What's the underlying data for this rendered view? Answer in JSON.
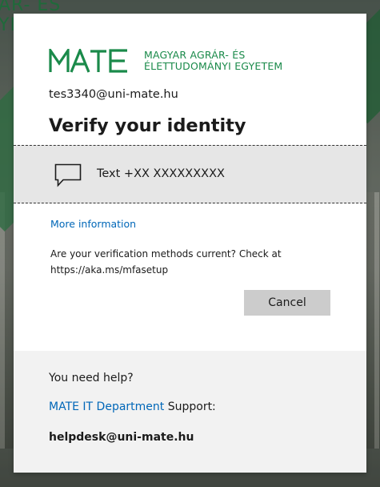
{
  "background": {
    "institution_text": "ÁR- ÉS\nYI"
  },
  "logo": {
    "mark": "MATE",
    "line1": "MAGYAR AGRÁR- ÉS",
    "line2": "ÉLETTUDOMÁNYI EGYETEM",
    "brand_color": "#1a8a4a"
  },
  "account_email": "tes3340@uni-mate.hu",
  "title": "Verify your identity",
  "method": {
    "icon": "message-icon",
    "label": "Text +XX XXXXXXXXX"
  },
  "more_info": "More information",
  "note": "Are your verification methods current? Check at https://aka.ms/mfasetup",
  "cancel_label": "Cancel",
  "help": {
    "title": "You need help?",
    "link_text": "MATE IT Department",
    "support_suffix": " Support:",
    "email": "helpdesk@uni-mate.hu"
  },
  "colors": {
    "link": "#0067b8",
    "cancel_bg": "#cccccc",
    "method_bg": "#e6e6e6",
    "help_bg": "#f2f2f2"
  }
}
